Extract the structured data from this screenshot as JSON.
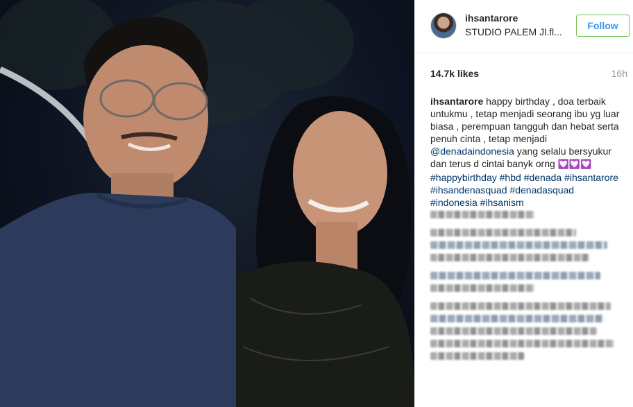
{
  "post": {
    "username": "ihsantarore",
    "location": "STUDIO PALEM Jl.fl...",
    "follow_label": "Follow",
    "likes": "14.7k likes",
    "time_ago": "16h"
  },
  "caption": {
    "username": "ihsantarore",
    "text_1": "happy birthday , doa terbaik untukmu , tetap menjadi seorang ibu yg luar biasa , perempuan tangguh dan hebat serta penuh cinta , tetap menjadi",
    "mention": "@denadaindonesia",
    "text_2": "yang selalu bersyukur dan terus d cintai banyk orng",
    "emoji": "💟💟💟",
    "hashtags": [
      "#happybirthday",
      "#hbd",
      "#denada",
      "#ihsantarore",
      "#ihsandenasquad",
      "#denadasquad",
      "#indonesia",
      "#ihsanism"
    ]
  },
  "icons": {
    "avatar": "profile-avatar",
    "emoji": "heart-decoration-emoji"
  },
  "colors": {
    "follow_text": "#3897f0",
    "follow_border": "#70c050",
    "link": "#003569",
    "meta": "#999999"
  }
}
